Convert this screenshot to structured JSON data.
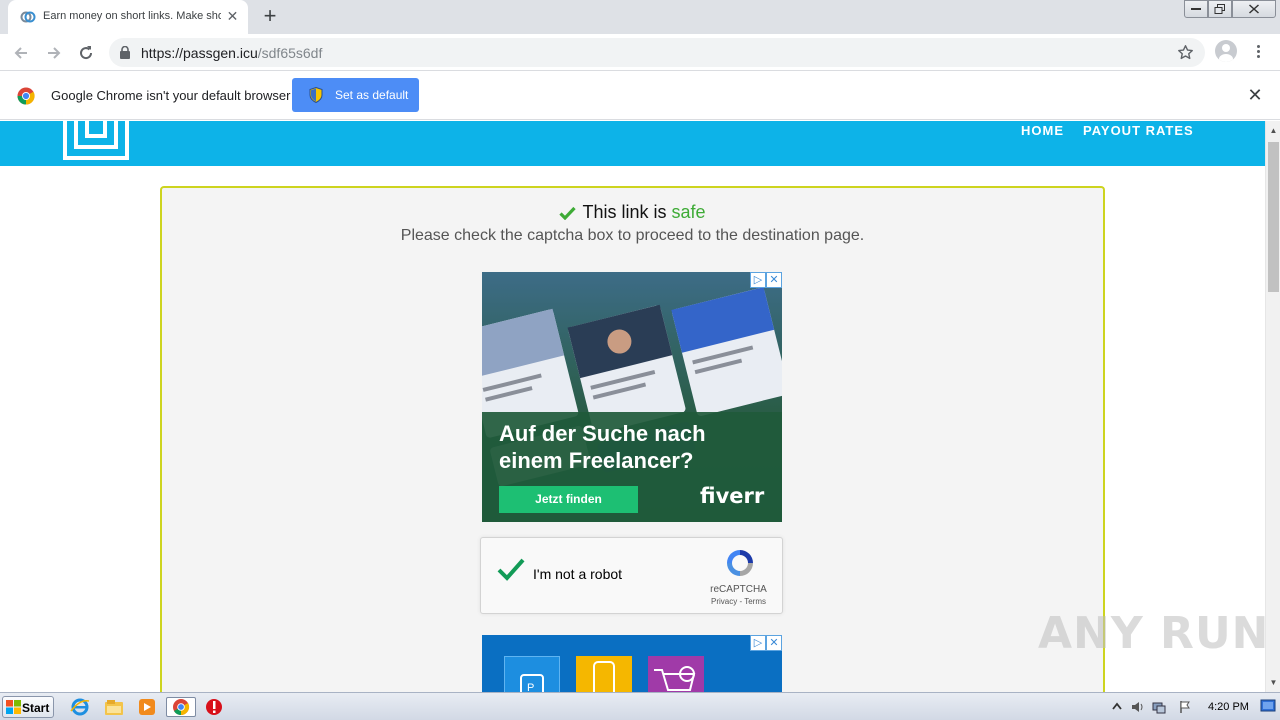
{
  "browser": {
    "tab_title": "Earn money on short links. Make sho",
    "url_host": "https://passgen.icu",
    "url_path": "/sdf65s6df",
    "new_tab_symbol": "+",
    "tab_close_symbol": "✕"
  },
  "infobar": {
    "message": "Google Chrome isn't your default browser",
    "button_label": "Set as default",
    "close_symbol": "✕"
  },
  "site": {
    "nav": [
      "HOME",
      "PAYOUT RATES"
    ],
    "brand_color": "#0db3e8",
    "safe_prefix": "This link is",
    "safe_word": "safe",
    "subtitle": "Please check the captcha box to proceed to the destination page."
  },
  "ad_fiverr": {
    "headline": "Auf der Suche nach einem Freelancer?",
    "cta": "Jetzt finden",
    "brand": "fiverr",
    "badge_info": "▷",
    "badge_close": "✕",
    "accent": "#1dbf73"
  },
  "recaptcha": {
    "label": "I'm not a robot",
    "brand": "reCAPTCHA",
    "terms": "Privacy - Terms",
    "checked": true
  },
  "ad_second": {
    "badge_info": "▷",
    "badge_close": "✕"
  },
  "taskbar": {
    "start_label": "Start",
    "clock": "4:20 PM",
    "icons": [
      "ie-icon",
      "explorer-icon",
      "media-player-icon",
      "chrome-icon",
      "stop-icon"
    ]
  },
  "watermark": "ANY RUN"
}
